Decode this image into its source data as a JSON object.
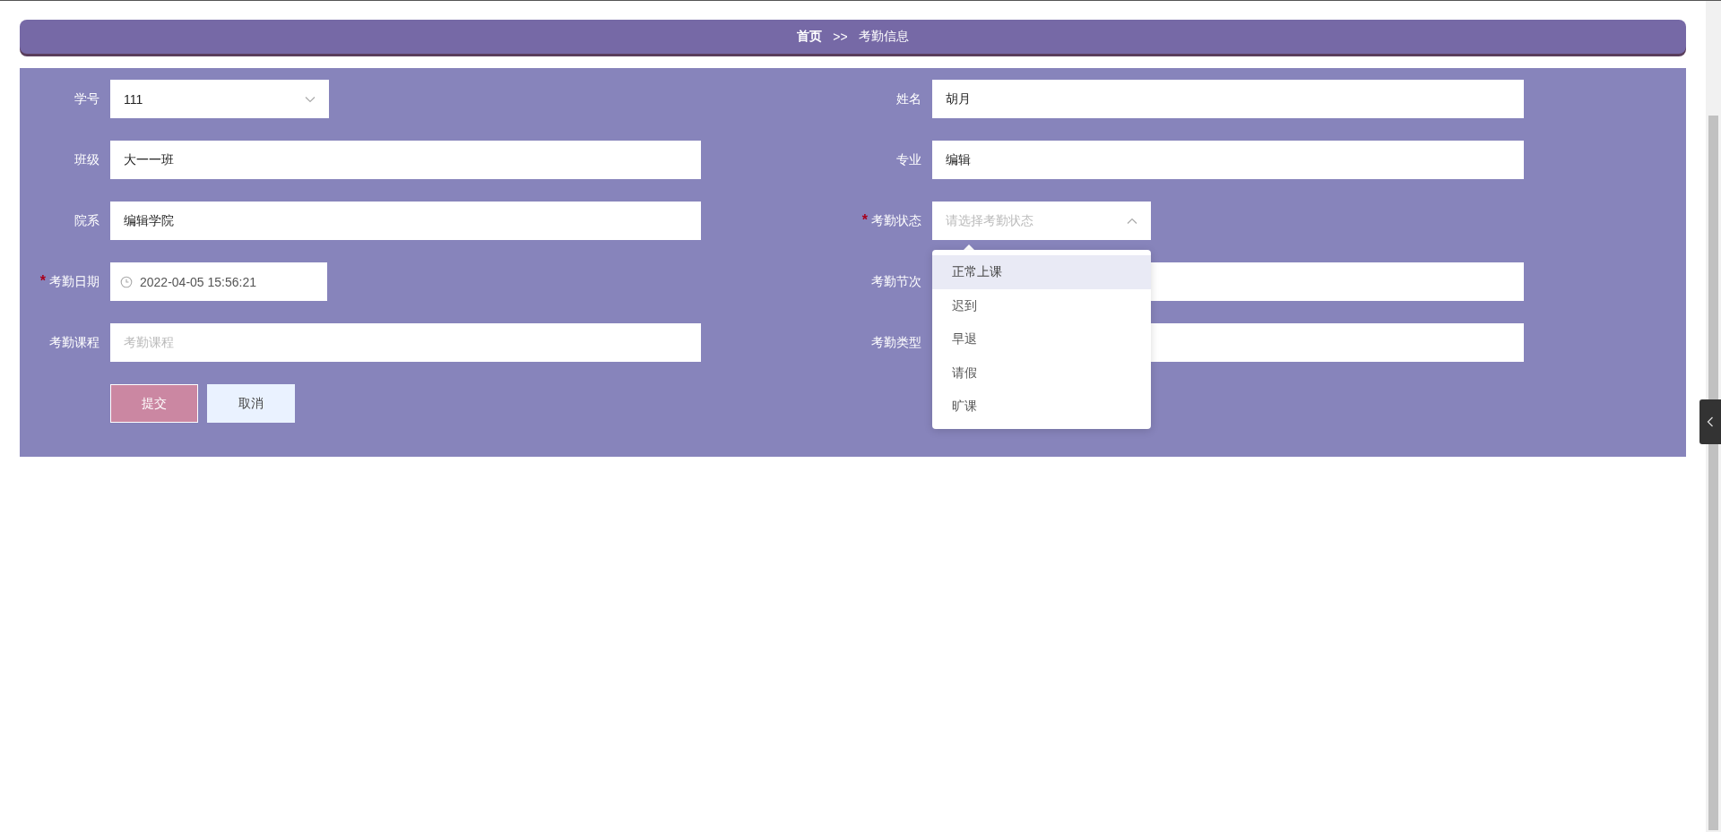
{
  "breadcrumb": {
    "home": "首页",
    "separator": ">>",
    "current": "考勤信息"
  },
  "required_mark": "*",
  "fields": [
    {
      "label": "学号",
      "kind": "select",
      "value": "111",
      "required": false,
      "expanded": false
    },
    {
      "label": "姓名",
      "kind": "input",
      "value": "胡月",
      "required": false
    },
    {
      "label": "班级",
      "kind": "input",
      "value": "大一一班",
      "required": false
    },
    {
      "label": "专业",
      "kind": "input",
      "value": "编辑",
      "required": false
    },
    {
      "label": "院系",
      "kind": "input",
      "value": "编辑学院",
      "required": false
    },
    {
      "label": "考勤状态",
      "kind": "select",
      "placeholder": "请选择考勤状态",
      "required": true,
      "expanded": true,
      "options": [
        {
          "label": "正常上课",
          "hovered": true
        },
        {
          "label": "迟到",
          "hovered": false
        },
        {
          "label": "早退",
          "hovered": false
        },
        {
          "label": "请假",
          "hovered": false
        },
        {
          "label": "旷课",
          "hovered": false
        }
      ]
    },
    {
      "label": "考勤日期",
      "kind": "datetime",
      "value": "2022-04-05 15:56:21",
      "required": true
    },
    {
      "label": "考勤节次",
      "kind": "input",
      "required": false
    },
    {
      "label": "考勤课程",
      "kind": "input",
      "placeholder": "考勤课程",
      "required": false
    },
    {
      "label": "考勤类型",
      "kind": "input",
      "required": false
    }
  ],
  "buttons": [
    {
      "label": "提交",
      "kind": "primary"
    },
    {
      "label": "取消",
      "kind": "secondary"
    }
  ]
}
